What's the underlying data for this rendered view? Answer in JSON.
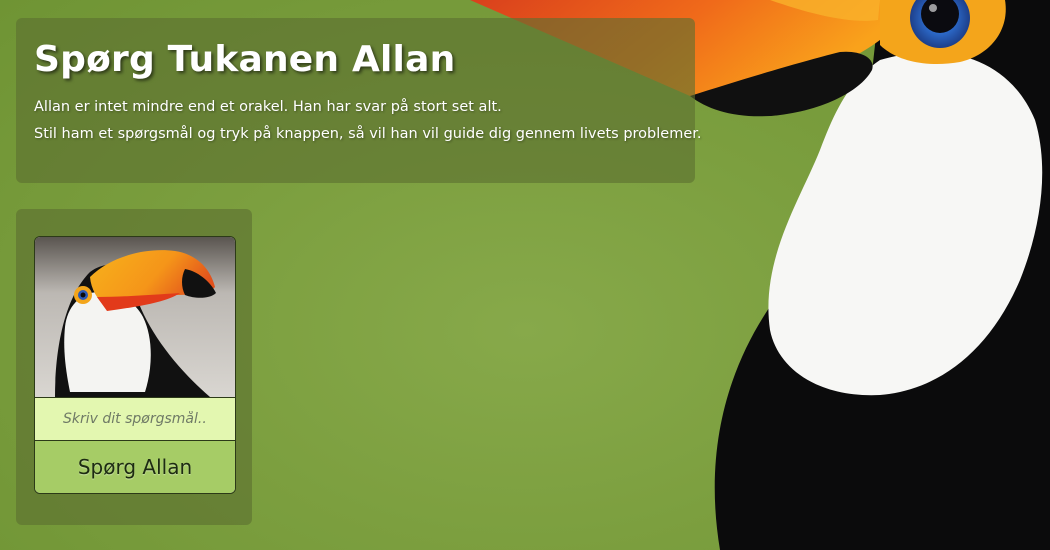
{
  "header": {
    "title": "Spørg Tukanen Allan",
    "line1": "Allan er intet mindre end et orakel. Han har svar på stort set alt.",
    "line2": "Stil ham et spørgsmål og tryk på knappen, så vil han vil guide dig gennem livets problemer."
  },
  "ask": {
    "placeholder": "Skriv dit spørgsmål...",
    "button_label": "Spørg Allan",
    "value": ""
  },
  "colors": {
    "background_green": "#7c9f3f",
    "panel_overlay": "#5c7030",
    "input_bg": "#e3f7b0",
    "button_bg": "#a6cc66"
  },
  "icons": {
    "background": "toucan-image",
    "card": "toucan-portrait-image"
  }
}
